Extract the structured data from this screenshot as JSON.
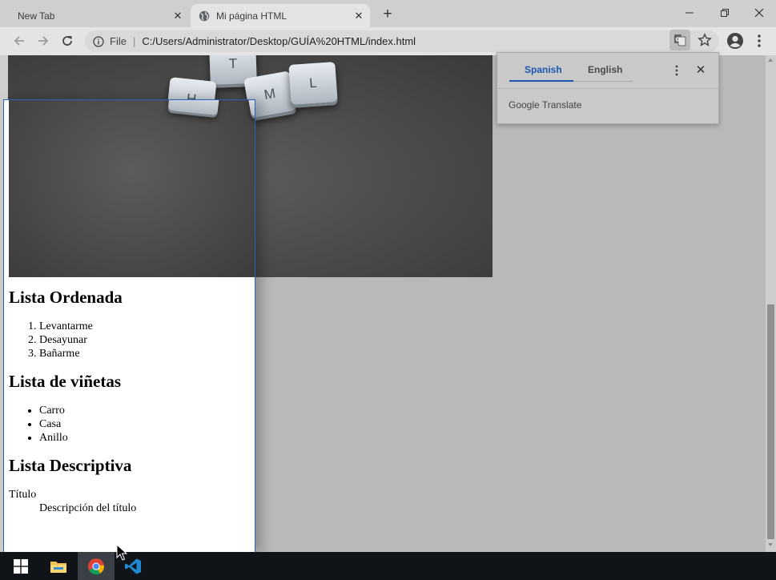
{
  "tabs": [
    {
      "title": "New Tab",
      "active": false
    },
    {
      "title": "Mi página HTML",
      "active": true
    }
  ],
  "toolbar": {
    "security_label": "File",
    "url": "C:/Users/Administrator/Desktop/GUÍA%20HTML/index.html"
  },
  "hero": {
    "keycaps": [
      "T",
      "H",
      "M",
      "L"
    ]
  },
  "translate_popup": {
    "languages": [
      "Spanish",
      "English"
    ],
    "selected": "Spanish",
    "footer": "Google Translate"
  },
  "document": {
    "ordered_heading": "Lista Ordenada",
    "ordered_items": [
      "Levantarme",
      "Desayunar",
      "Bañarme"
    ],
    "bullet_heading": "Lista de viñetas",
    "bullet_items": [
      "Carro",
      "Casa",
      "Anillo"
    ],
    "descriptive_heading": "Lista Descriptiva",
    "term": "Título",
    "definition": "Descripción del título"
  },
  "taskbar": {
    "apps": [
      "start-icon",
      "file-explorer-icon",
      "chrome-icon",
      "vscode-icon"
    ],
    "active_app": "chrome-icon"
  },
  "colors": {
    "accent_blue": "#1a56b0",
    "window_border": "#2b63b8",
    "taskbar": "#101418"
  }
}
